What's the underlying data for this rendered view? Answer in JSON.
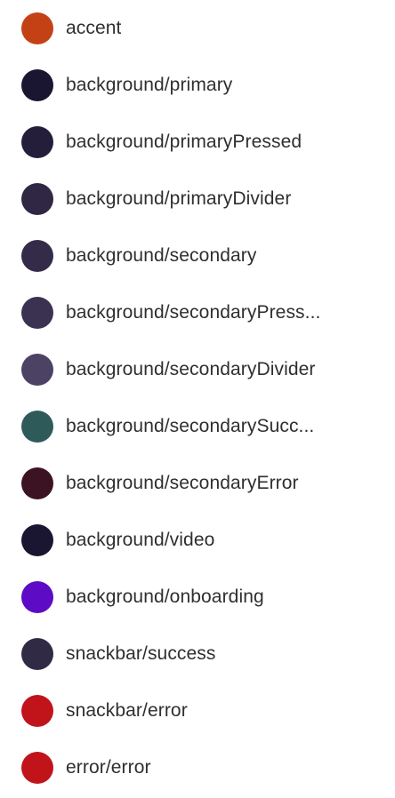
{
  "colors": [
    {
      "label": "accent",
      "swatch": "#C44116"
    },
    {
      "label": "background/primary",
      "swatch": "#1A1530"
    },
    {
      "label": "background/primaryPressed",
      "swatch": "#241E3A"
    },
    {
      "label": "background/primaryDivider",
      "swatch": "#2F2743"
    },
    {
      "label": "background/secondary",
      "swatch": "#342B48"
    },
    {
      "label": "background/secondaryPress...",
      "swatch": "#3A3250"
    },
    {
      "label": "background/secondaryDivider",
      "swatch": "#4C4263"
    },
    {
      "label": "background/secondarySucc...",
      "swatch": "#2E5B59"
    },
    {
      "label": "background/secondaryError",
      "swatch": "#3C1322"
    },
    {
      "label": "background/video",
      "swatch": "#1A1530"
    },
    {
      "label": "background/onboarding",
      "swatch": "#5D0BC5"
    },
    {
      "label": "snackbar/success",
      "swatch": "#312A45"
    },
    {
      "label": "snackbar/error",
      "swatch": "#C0141A"
    },
    {
      "label": "error/error",
      "swatch": "#C0141A"
    }
  ]
}
